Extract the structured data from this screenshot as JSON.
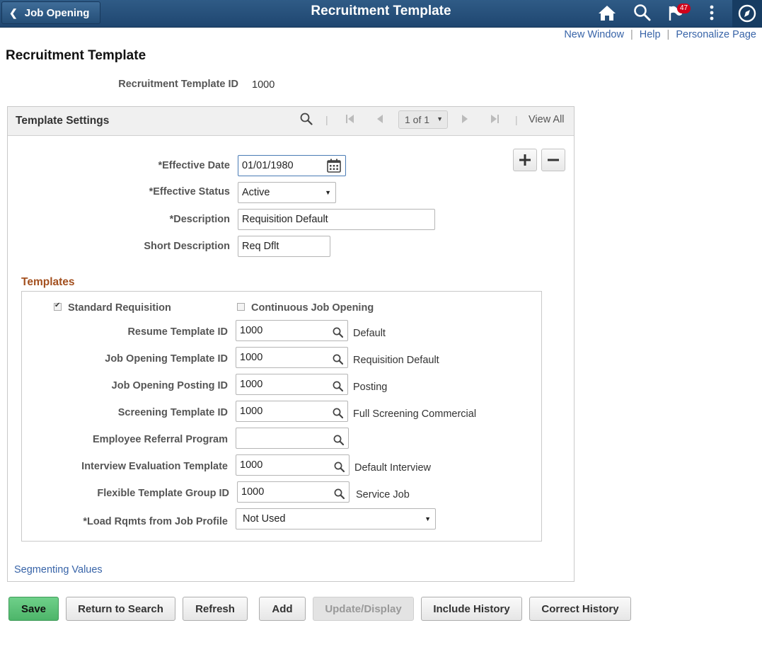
{
  "header": {
    "back_label": "Job Opening",
    "title": "Recruitment Template",
    "notifications_count": "47",
    "icons": [
      "home-icon",
      "search-icon",
      "notification-flag-icon",
      "actions-menu-icon",
      "navbar-compass-icon"
    ]
  },
  "top_links": {
    "new_window": "New Window",
    "help": "Help",
    "personalize": "Personalize Page",
    "separator": "|"
  },
  "page": {
    "title": "Recruitment Template",
    "template_id_label": "Recruitment Template ID",
    "template_id_value": "1000"
  },
  "settings": {
    "title": "Template Settings",
    "pager": "1 of 1",
    "divider": "|",
    "view_all": "View All",
    "effective_date_label": "*Effective Date",
    "effective_date_value": "01/01/1980",
    "effective_status_label": "*Effective Status",
    "effective_status_value": "Active",
    "description_label": "*Description",
    "description_value": "Requisition Default",
    "short_description_label": "Short Description",
    "short_description_value": "Req Dflt"
  },
  "templates": {
    "title": "Templates",
    "standard_requisition_label": "Standard Requisition",
    "standard_requisition_checked": true,
    "continuous_job_opening_label": "Continuous Job Opening",
    "continuous_job_opening_checked": false,
    "rows": [
      {
        "label": "Resume Template ID",
        "value": "1000",
        "desc": "Default"
      },
      {
        "label": "Job Opening Template ID",
        "value": "1000",
        "desc": "Requisition Default"
      },
      {
        "label": "Job Opening Posting ID",
        "value": "1000",
        "desc": "Posting"
      },
      {
        "label": "Screening Template ID",
        "value": "1000",
        "desc": "Full Screening Commercial"
      },
      {
        "label": "Employee Referral Program",
        "value": "",
        "desc": ""
      },
      {
        "label": "Interview Evaluation Template",
        "value": "1000",
        "desc": "Default Interview"
      },
      {
        "label": "Flexible Template Group ID",
        "value": "1000",
        "desc": "Service Job"
      }
    ],
    "load_rqmts_label": "*Load Rqmts from Job Profile",
    "load_rqmts_value": "Not Used"
  },
  "segmenting_values_link": "Segmenting Values",
  "footer": {
    "save": "Save",
    "return_to_search": "Return to Search",
    "refresh": "Refresh",
    "add": "Add",
    "update_display": "Update/Display",
    "include_history": "Include History",
    "correct_history": "Correct History"
  },
  "colors": {
    "banner": "#1f4670",
    "link": "#3864a8",
    "section_title": "#a3501f",
    "save_button": "#4db56a"
  }
}
